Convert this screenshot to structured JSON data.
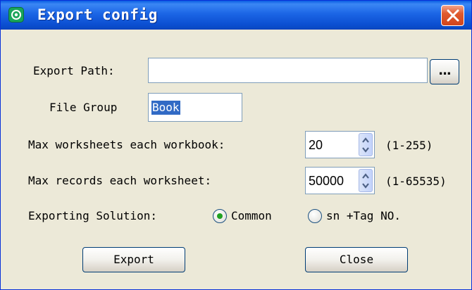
{
  "window": {
    "title": "Export config"
  },
  "export_path": {
    "label": "Export Path:",
    "value": "",
    "browse_label": "..."
  },
  "file_group": {
    "label": "File Group",
    "value": "Book"
  },
  "max_worksheets": {
    "label": "Max worksheets each workbook:",
    "value": "20",
    "range": "(1-255)"
  },
  "max_records": {
    "label": "Max records each worksheet:",
    "value": "50000",
    "range": "(1-65535)"
  },
  "solution": {
    "label": "Exporting Solution:",
    "options": [
      {
        "label": "Common",
        "selected": true
      },
      {
        "label": "sn +Tag NO.",
        "selected": false
      }
    ]
  },
  "buttons": {
    "export": "Export",
    "close": "Close"
  },
  "icons": {
    "app": "app-icon",
    "close": "close-icon",
    "spin_up": "spin-up-icon",
    "spin_down": "spin-down-icon"
  }
}
